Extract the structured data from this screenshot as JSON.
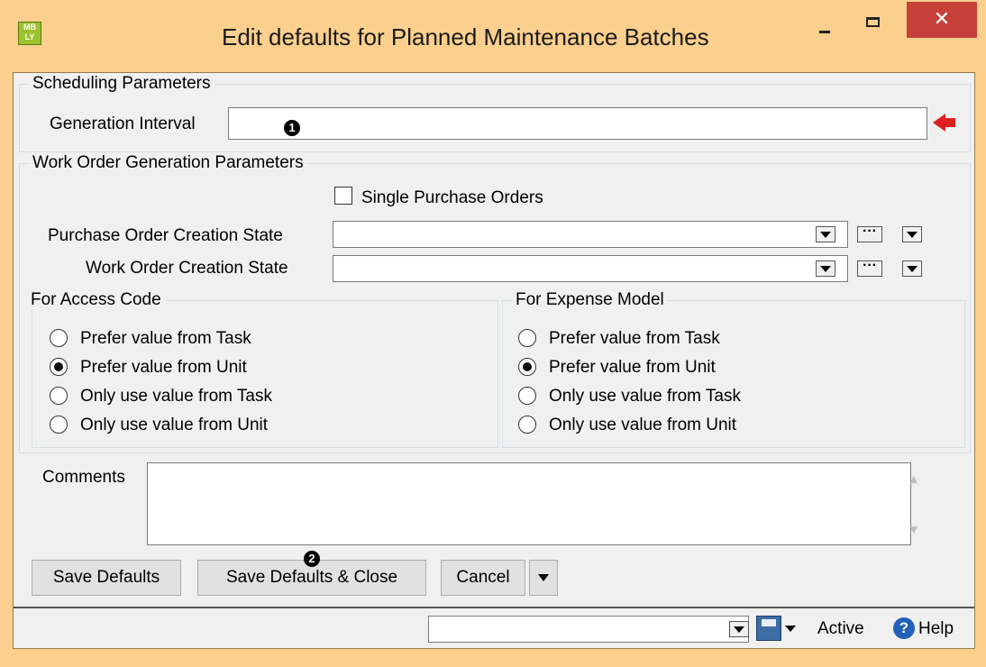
{
  "window": {
    "title": "Edit defaults for Planned Maintenance Batches",
    "icon_text": "MB\nLY",
    "close_glyph": "✕"
  },
  "scheduling": {
    "group_title": "Scheduling Parameters",
    "generation_interval_label": "Generation Interval",
    "generation_interval_value": "",
    "badge_1": "1"
  },
  "work_order": {
    "group_title": "Work Order Generation Parameters",
    "single_po_label": "Single Purchase Orders",
    "single_po_checked": false,
    "po_state_label": "Purchase Order Creation State",
    "po_state_value": "",
    "wo_state_label": "Work Order Creation State",
    "wo_state_value": "",
    "ellipsis": "···"
  },
  "access_code": {
    "group_title": "For Access Code",
    "options": [
      "Prefer value from Task",
      "Prefer value from Unit",
      "Only use value from Task",
      "Only use value from Unit"
    ],
    "selected": 1
  },
  "expense_model": {
    "group_title": "For Expense Model",
    "options": [
      "Prefer value from Task",
      "Prefer value from Unit",
      "Only use value from Task",
      "Only use value from Unit"
    ],
    "selected": 1
  },
  "comments": {
    "label": "Comments",
    "value": ""
  },
  "buttons": {
    "save_defaults": "Save Defaults",
    "save_close": "Save Defaults & Close",
    "cancel": "Cancel",
    "badge_2": "2"
  },
  "statusbar": {
    "combo_value": "",
    "status": "Active",
    "help": "Help"
  },
  "colors": {
    "titlebar": "#fbcf8d",
    "close": "#c7403a",
    "required_arrow": "#e02020"
  }
}
